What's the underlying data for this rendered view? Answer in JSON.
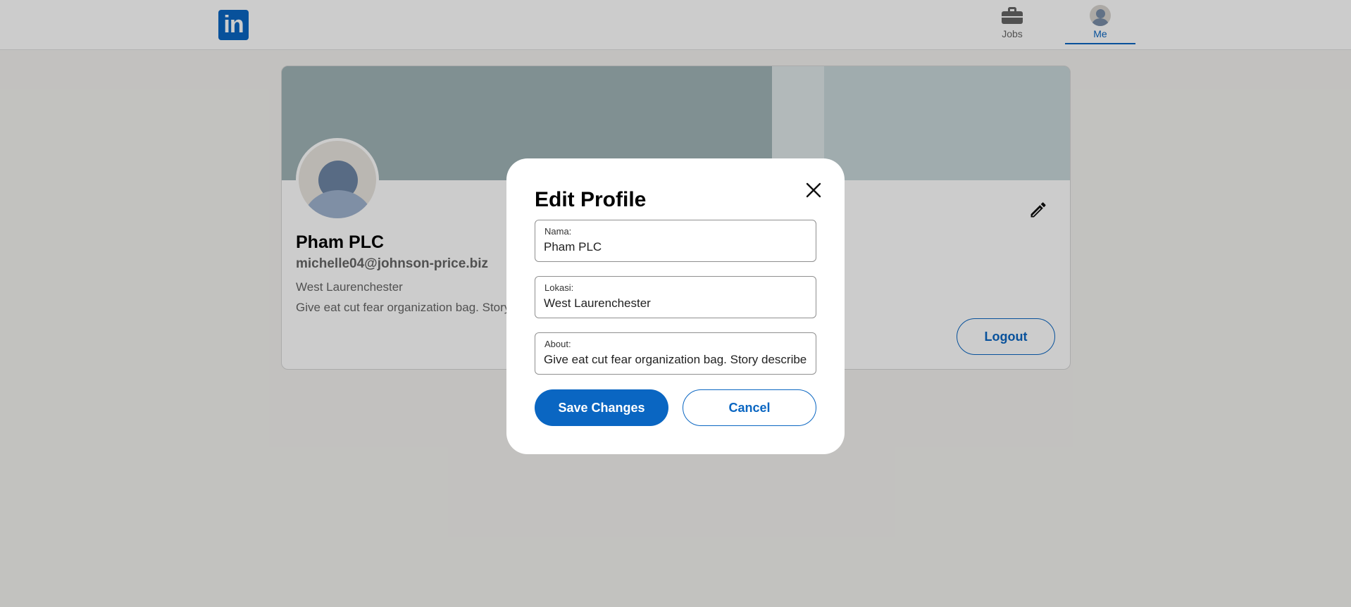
{
  "nav": {
    "logo_text": "in",
    "jobs_label": "Jobs",
    "me_label": "Me"
  },
  "profile": {
    "name": "Pham PLC",
    "email": "michelle04@johnson-price.biz",
    "location": "West Laurenchester",
    "about": "Give eat cut fear organization bag. Story describe",
    "logout_label": "Logout"
  },
  "modal": {
    "title": "Edit Profile",
    "fields": [
      {
        "label": "Nama:",
        "value": "Pham PLC"
      },
      {
        "label": "Lokasi:",
        "value": "West Laurenchester"
      },
      {
        "label": "About:",
        "value": "Give eat cut fear organization bag. Story describe"
      }
    ],
    "save_label": "Save Changes",
    "cancel_label": "Cancel"
  },
  "colors": {
    "brand": "#0a66c2",
    "page_bg": "#f3f2ef"
  },
  "icons": [
    "briefcase-icon",
    "avatar-icon",
    "pencil-icon",
    "close-icon"
  ]
}
